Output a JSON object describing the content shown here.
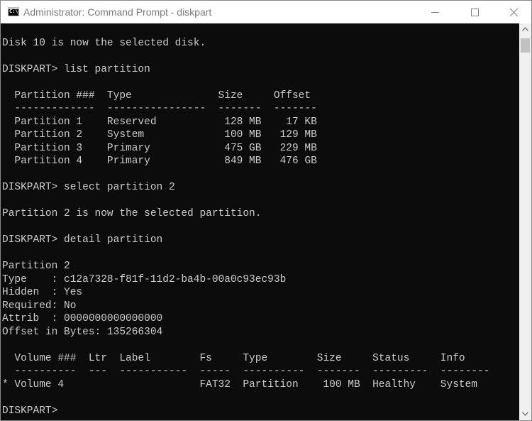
{
  "window": {
    "title": "Administrator: Command Prompt - diskpart",
    "app_icon_label": "C:\\."
  },
  "icons": {
    "app": "command-prompt-icon",
    "minimize": "minimize-icon",
    "maximize": "maximize-icon",
    "close": "close-icon",
    "scroll_up": "chevron-up-icon",
    "scroll_down": "chevron-down-icon"
  },
  "colors": {
    "console_background": "#0c0c0c",
    "console_text": "#cccccc",
    "titlebar_text": "#7a7a7a"
  },
  "console": {
    "lines": [
      "",
      "Disk 10 is now the selected disk.",
      "",
      "DISKPART> list partition",
      "",
      "  Partition ###  Type              Size     Offset",
      "  -------------  ----------------  -------  -------",
      "  Partition 1    Reserved           128 MB    17 KB",
      "  Partition 2    System             100 MB   129 MB",
      "  Partition 3    Primary            475 GB   229 MB",
      "  Partition 4    Primary            849 MB   476 GB",
      "",
      "DISKPART> select partition 2",
      "",
      "Partition 2 is now the selected partition.",
      "",
      "DISKPART> detail partition",
      "",
      "Partition 2",
      "Type    : c12a7328-f81f-11d2-ba4b-00a0c93ec93b",
      "Hidden  : Yes",
      "Required: No",
      "Attrib  : 0000000000000000",
      "Offset in Bytes: 135266304",
      "",
      "  Volume ###  Ltr  Label        Fs     Type        Size     Status     Info",
      "  ----------  ---  -----------  -----  ----------  -------  ---------  --------",
      "* Volume 4                      FAT32  Partition    100 MB  Healthy    System",
      "",
      "DISKPART> "
    ]
  }
}
